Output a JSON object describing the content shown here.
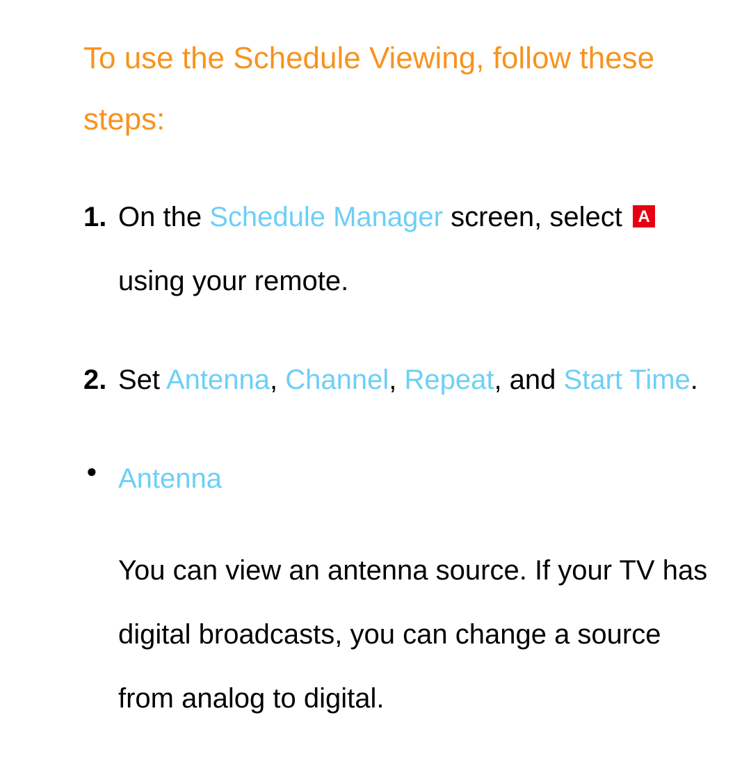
{
  "heading": "To use the Schedule Viewing, follow these steps:",
  "steps": {
    "step1": {
      "text_before": "On the ",
      "highlight1": "Schedule Manager",
      "text_mid": " screen, select ",
      "button_label": "A",
      "text_after": " using your remote."
    },
    "step2": {
      "text_before": "Set ",
      "highlight1": "Antenna",
      "sep1": ", ",
      "highlight2": "Channel",
      "sep2": ", ",
      "highlight3": "Repeat",
      "sep3": ", and ",
      "highlight4": "Start Time",
      "text_after": "."
    }
  },
  "bullet": {
    "title": "Antenna",
    "body": "You can view an antenna source. If your TV has digital broadcasts, you can change a source from analog to digital."
  }
}
